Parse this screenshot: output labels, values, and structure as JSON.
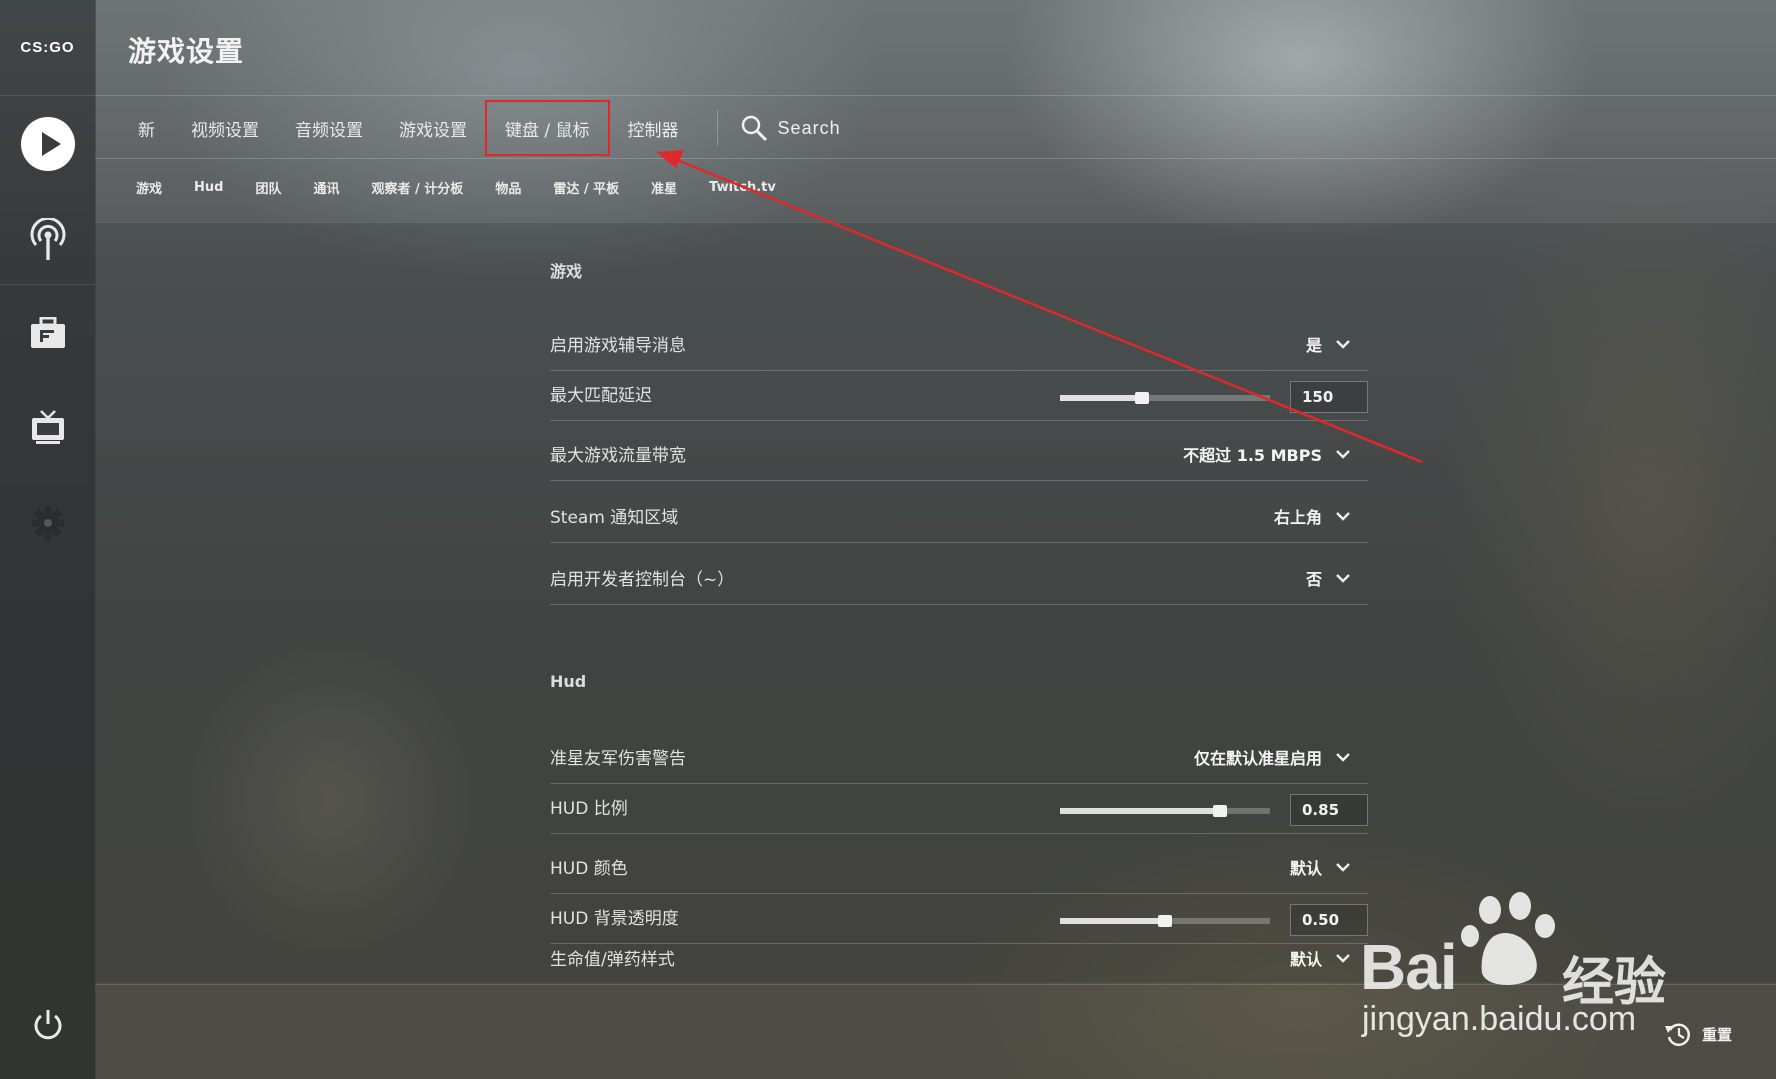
{
  "app": {
    "logo_text": "CS:GO"
  },
  "header": {
    "title": "游戏设置"
  },
  "main_tabs": [
    {
      "label": "新"
    },
    {
      "label": "视频设置"
    },
    {
      "label": "音频设置"
    },
    {
      "label": "游戏设置"
    },
    {
      "label": "键盘 / 鼠标",
      "active": true
    },
    {
      "label": "控制器"
    }
  ],
  "search": {
    "label": "Search"
  },
  "sub_tabs": [
    {
      "label": "游戏"
    },
    {
      "label": "Hud"
    },
    {
      "label": "团队"
    },
    {
      "label": "通讯"
    },
    {
      "label": "观察者 / 计分板"
    },
    {
      "label": "物品"
    },
    {
      "label": "雷达 / 平板"
    },
    {
      "label": "准星"
    },
    {
      "label": "Twitch.tv"
    }
  ],
  "sections": {
    "game": {
      "title": "游戏",
      "rows": [
        {
          "label": "启用游戏辅导消息",
          "type": "dropdown",
          "value": "是"
        },
        {
          "label": "最大匹配延迟",
          "type": "slider",
          "value": "150",
          "fraction": 0.39
        },
        {
          "label": "最大游戏流量带宽",
          "type": "dropdown",
          "value": "不超过 1.5 MBPS"
        },
        {
          "label": "Steam 通知区域",
          "type": "dropdown",
          "value": "右上角"
        },
        {
          "label": "启用开发者控制台（~）",
          "type": "dropdown",
          "value": "否"
        }
      ]
    },
    "hud": {
      "title": "Hud",
      "rows": [
        {
          "label": "准星友军伤害警告",
          "type": "dropdown",
          "value": "仅在默认准星启用"
        },
        {
          "label": "HUD 比例",
          "type": "slider",
          "value": "0.85",
          "fraction": 0.76
        },
        {
          "label": "HUD 颜色",
          "type": "dropdown",
          "value": "默认"
        },
        {
          "label": "HUD 背景透明度",
          "type": "slider",
          "value": "0.50",
          "fraction": 0.5
        },
        {
          "label": "生命值/弹药样式",
          "type": "dropdown",
          "value": "默认"
        }
      ]
    }
  },
  "footer": {
    "reset_label": "重置"
  },
  "watermark": {
    "brand": "Bai",
    "brand_cn": "经验",
    "url": "jingyan.baidu.com"
  },
  "colors": {
    "highlight": "#e02828",
    "text": "#e6e6e6"
  },
  "icons": [
    "play-icon",
    "broadcast-icon",
    "briefcase-icon",
    "tv-icon",
    "gear-icon",
    "power-icon",
    "search-icon",
    "chevron-down-icon",
    "reset-history-icon",
    "paw-icon"
  ]
}
